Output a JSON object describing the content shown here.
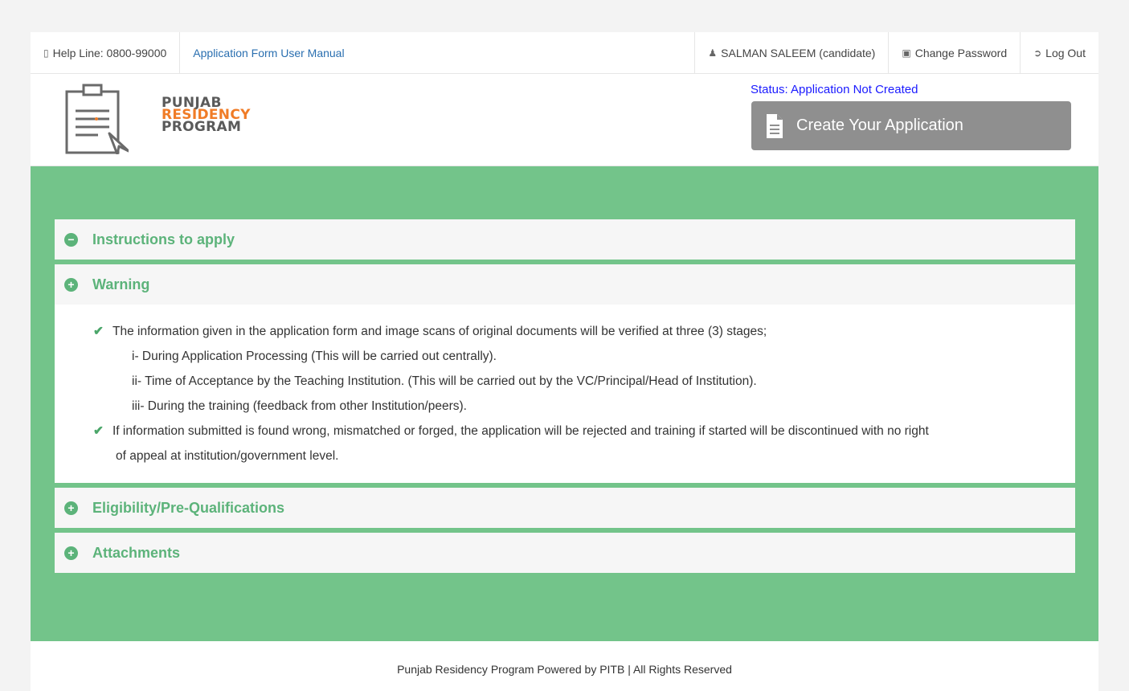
{
  "topbar": {
    "helpline": "Help Line: 0800-99000",
    "manual_link": "Application Form User Manual",
    "user": "SALMAN SALEEM (candidate)",
    "change_password": "Change Password",
    "logout": "Log Out"
  },
  "logo": {
    "line1": "PUNJAB",
    "line2": "RESIDENCY",
    "line3": "PROGRAM"
  },
  "status": "Status: Application Not Created",
  "create_button": "Create Your Application",
  "accordion": {
    "instructions": {
      "title": "Instructions to apply",
      "toggle": "−"
    },
    "warning": {
      "title": "Warning",
      "toggle": "+",
      "item1": "The information given in the application form and image scans of original documents will be verified at three (3) stages;",
      "sub1": "i- During Application Processing (This will be carried out centrally).",
      "sub2": "ii- Time of Acceptance by the Teaching Institution. (This will be carried out by the VC/Principal/Head of Institution).",
      "sub3": "iii- During the training (feedback from other Institution/peers).",
      "item2a": "If information submitted is found wrong, mismatched or forged, the application will be rejected and training if started will be discontinued with no right",
      "item2b": "of appeal at institution/government level."
    },
    "eligibility": {
      "title": "Eligibility/Pre-Qualifications",
      "toggle": "+"
    },
    "attachments": {
      "title": "Attachments",
      "toggle": "+"
    }
  },
  "footer": "Punjab Residency Program Powered by PITB | All Rights Reserved",
  "colors": {
    "green_bg": "#73c48a",
    "accent_green": "#5cb37a",
    "logo_orange": "#f07c27",
    "button_gray": "#8f8f8f",
    "status_blue": "#1a1aff"
  }
}
